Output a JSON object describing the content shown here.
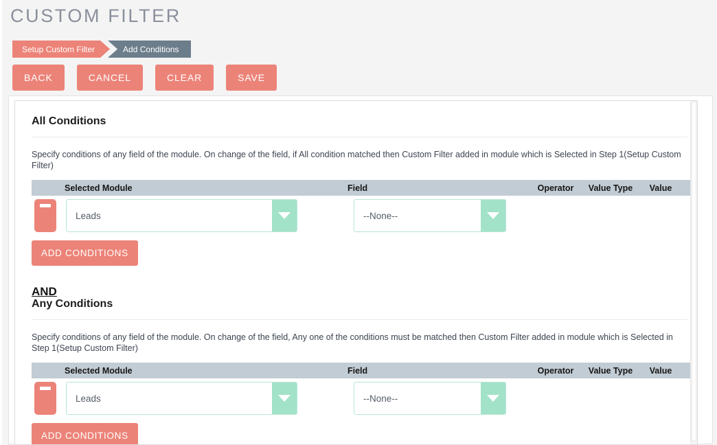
{
  "page": {
    "title": "CUSTOM FILTER"
  },
  "wizard": {
    "steps": [
      {
        "label": "Setup Custom Filter",
        "state": "done"
      },
      {
        "label": "Add Conditions",
        "state": "current"
      }
    ]
  },
  "toolbar": {
    "back_label": "BACK",
    "cancel_label": "CANCEL",
    "clear_label": "CLEAR",
    "save_label": "SAVE"
  },
  "columns": {
    "selected_module": "Selected Module",
    "field": "Field",
    "operator": "Operator",
    "value_type": "Value Type",
    "value": "Value"
  },
  "all_conditions": {
    "heading": "All Conditions",
    "description": "Specify conditions of any field of the module. On change of the field, if All condition matched then Custom Filter added in module which is Selected in Step 1(Setup Custom Filter)",
    "rows": [
      {
        "module": "Leads",
        "field": "--None--",
        "operator": "",
        "value_type": "",
        "value": ""
      }
    ],
    "add_button": "ADD CONDITIONS"
  },
  "operator_join": "AND",
  "any_conditions": {
    "heading": "Any Conditions",
    "description": "Specify conditions of any field of the module. On change of the field, Any one of the conditions must be matched then Custom Filter added in module which is Selected in Step 1(Setup Custom Filter)",
    "rows": [
      {
        "module": "Leads",
        "field": "--None--",
        "operator": "",
        "value_type": "",
        "value": ""
      }
    ],
    "add_button": "ADD CONDITIONS"
  },
  "colors": {
    "accent_salmon": "#ec8378",
    "step_current_gray": "#6c7d8c",
    "table_header_gray": "#c2ccd4",
    "dropdown_mint": "#a2e2c9",
    "dropdown_border": "#b7e6d4",
    "page_bg": "#f4f4f4"
  }
}
